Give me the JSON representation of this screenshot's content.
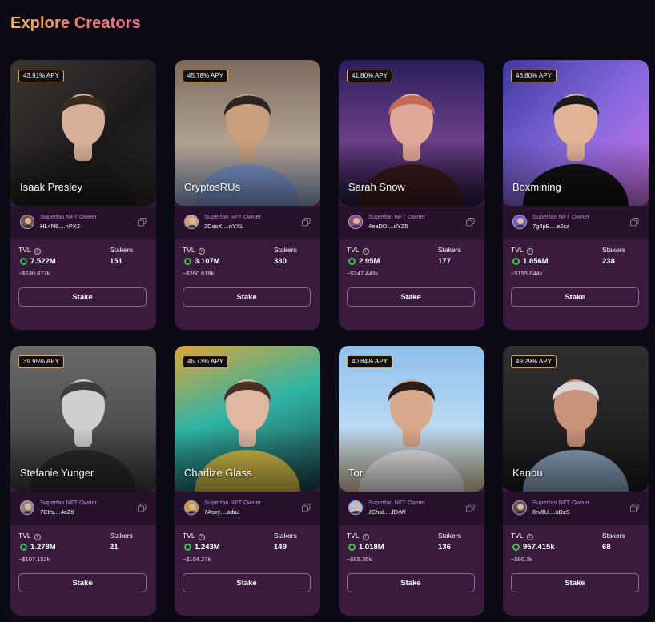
{
  "header": {
    "title": "Explore Creators"
  },
  "labels": {
    "owner_label": "Superfan NFT Owner",
    "tvl": "TVL",
    "stakers": "Stakers",
    "stake_button": "Stake",
    "info_glyph": "i"
  },
  "icons": {
    "copy": "copy-icon",
    "info": "info-icon",
    "tvl_ring": "token-ring-icon"
  },
  "colors": {
    "card_bg": "#3a1b3e",
    "owner_row_bg": "#27122b",
    "apy_border": "#f0a53b",
    "tvl_ring": "#34c94a",
    "owner_label": "#c58be0",
    "title_gradient": [
      "#f5b84a",
      "#ea6f8c"
    ]
  },
  "creators": [
    {
      "name": "Isaak Presley",
      "apy": "43.91% APY",
      "owner_address": "HL4N9....nPX2",
      "tvl": "7.522M",
      "usd": "~$630.877k",
      "stakers": "151"
    },
    {
      "name": "CryptosRUs",
      "apy": "45.78% APY",
      "owner_address": "2DasX....nYXL",
      "tvl": "3.107M",
      "usd": "~$260.618k",
      "stakers": "330"
    },
    {
      "name": "Sarah Snow",
      "apy": "41.80% APY",
      "owner_address": "4eaDD....dYZ5",
      "tvl": "2.95M",
      "usd": "~$247.443k",
      "stakers": "177"
    },
    {
      "name": "Boxmining",
      "apy": "46.80% APY",
      "owner_address": "7g4pB....e2cz",
      "tvl": "1.856M",
      "usd": "~$155.644k",
      "stakers": "238"
    },
    {
      "name": "Stefanie Yunger",
      "apy": "39.95% APY",
      "owner_address": "7Ctfs....4cZ6",
      "tvl": "1.278M",
      "usd": "~$107.152k",
      "stakers": "21"
    },
    {
      "name": "Charlize Glass",
      "apy": "45.73% APY",
      "owner_address": "7Asxy....adaJ",
      "tvl": "1.243M",
      "usd": "~$104.27k",
      "stakers": "149"
    },
    {
      "name": "Tori",
      "apy": "40.84% APY",
      "owner_address": "JChsL....fDrW",
      "tvl": "1.018M",
      "usd": "~$85.35k",
      "stakers": "136"
    },
    {
      "name": "Kanou",
      "apy": "49.29% APY",
      "owner_address": "8rv8U....uDzS",
      "tvl": "957.415k",
      "usd": "~$80.3k",
      "stakers": "68"
    }
  ]
}
